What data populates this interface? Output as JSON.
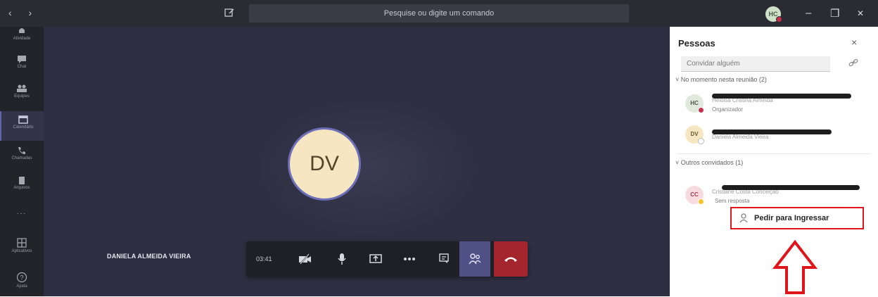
{
  "titlebar": {
    "search_placeholder": "Pesquise ou digite um comando",
    "avatar_initials": "HC",
    "minimize": "–",
    "maximize": "❐",
    "close": "✕"
  },
  "rail": {
    "items": [
      {
        "label": "Atividade",
        "icon": "bell-icon"
      },
      {
        "label": "Chat",
        "icon": "chat-icon"
      },
      {
        "label": "Equipes",
        "icon": "teams-icon"
      },
      {
        "label": "Calendário",
        "icon": "calendar-icon"
      },
      {
        "label": "Chamadas",
        "icon": "phone-icon"
      },
      {
        "label": "Arquivos",
        "icon": "files-icon"
      },
      {
        "label": "...",
        "icon": "more-icon"
      },
      {
        "label": "Aplicativos",
        "icon": "apps-icon"
      },
      {
        "label": "Ajuda",
        "icon": "help-icon"
      }
    ]
  },
  "stage": {
    "avatar_initials": "DV",
    "participant_name": "DANIELA ALMEIDA VIEIRA"
  },
  "callbar": {
    "timer": "03:41",
    "buttons": [
      "video-off-icon",
      "microphone-icon",
      "share-screen-icon",
      "more-options-icon",
      "chat-icon",
      "people-icon",
      "hangup-icon"
    ]
  },
  "panel": {
    "title": "Pessoas",
    "close": "×",
    "invite_placeholder": "Convidar alguém",
    "in_meeting_header": "No momento nesta reunião (2)",
    "participants": [
      {
        "initials": "HC",
        "role": "Organizador",
        "status_color": "#c4314b",
        "avatar_bg": "#dfe9dc",
        "avatar_fg": "#4a5a47"
      },
      {
        "initials": "DV",
        "role": "",
        "status_color": "#ffffff",
        "avatar_bg": "#f6e7c2",
        "avatar_fg": "#6e5a2e"
      }
    ],
    "others_header": "Outros convidados (1)",
    "others": [
      {
        "initials": "CC",
        "role": "Sem resposta",
        "status_color": "#f8c22e",
        "avatar_bg": "#f7dbe0",
        "avatar_fg": "#9c3b4e"
      }
    ],
    "ask_to_join_label": "Pedir para Ingressar"
  },
  "colors": {
    "accent": "#6264a7",
    "hangup": "#a4262c",
    "highlight": "#e0151c",
    "stage": "#2e2f42"
  }
}
